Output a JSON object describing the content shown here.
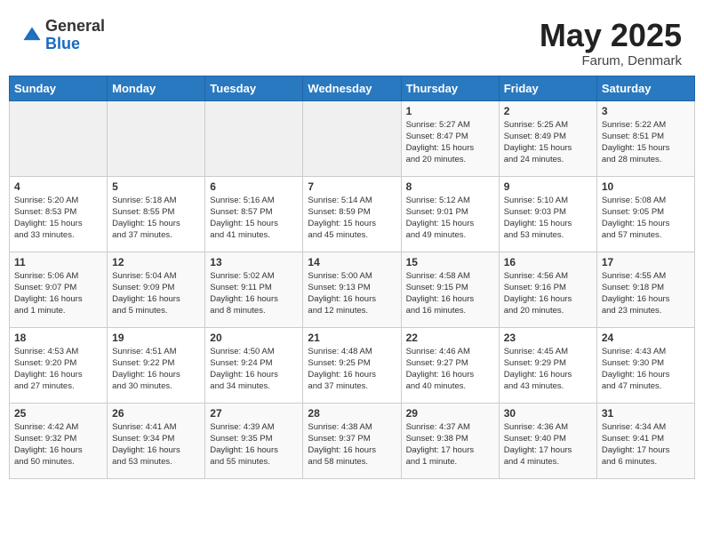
{
  "header": {
    "logo_general": "General",
    "logo_blue": "Blue",
    "title": "May 2025",
    "location": "Farum, Denmark"
  },
  "weekdays": [
    "Sunday",
    "Monday",
    "Tuesday",
    "Wednesday",
    "Thursday",
    "Friday",
    "Saturday"
  ],
  "weeks": [
    [
      {
        "day": "",
        "content": ""
      },
      {
        "day": "",
        "content": ""
      },
      {
        "day": "",
        "content": ""
      },
      {
        "day": "",
        "content": ""
      },
      {
        "day": "1",
        "content": "Sunrise: 5:27 AM\nSunset: 8:47 PM\nDaylight: 15 hours\nand 20 minutes."
      },
      {
        "day": "2",
        "content": "Sunrise: 5:25 AM\nSunset: 8:49 PM\nDaylight: 15 hours\nand 24 minutes."
      },
      {
        "day": "3",
        "content": "Sunrise: 5:22 AM\nSunset: 8:51 PM\nDaylight: 15 hours\nand 28 minutes."
      }
    ],
    [
      {
        "day": "4",
        "content": "Sunrise: 5:20 AM\nSunset: 8:53 PM\nDaylight: 15 hours\nand 33 minutes."
      },
      {
        "day": "5",
        "content": "Sunrise: 5:18 AM\nSunset: 8:55 PM\nDaylight: 15 hours\nand 37 minutes."
      },
      {
        "day": "6",
        "content": "Sunrise: 5:16 AM\nSunset: 8:57 PM\nDaylight: 15 hours\nand 41 minutes."
      },
      {
        "day": "7",
        "content": "Sunrise: 5:14 AM\nSunset: 8:59 PM\nDaylight: 15 hours\nand 45 minutes."
      },
      {
        "day": "8",
        "content": "Sunrise: 5:12 AM\nSunset: 9:01 PM\nDaylight: 15 hours\nand 49 minutes."
      },
      {
        "day": "9",
        "content": "Sunrise: 5:10 AM\nSunset: 9:03 PM\nDaylight: 15 hours\nand 53 minutes."
      },
      {
        "day": "10",
        "content": "Sunrise: 5:08 AM\nSunset: 9:05 PM\nDaylight: 15 hours\nand 57 minutes."
      }
    ],
    [
      {
        "day": "11",
        "content": "Sunrise: 5:06 AM\nSunset: 9:07 PM\nDaylight: 16 hours\nand 1 minute."
      },
      {
        "day": "12",
        "content": "Sunrise: 5:04 AM\nSunset: 9:09 PM\nDaylight: 16 hours\nand 5 minutes."
      },
      {
        "day": "13",
        "content": "Sunrise: 5:02 AM\nSunset: 9:11 PM\nDaylight: 16 hours\nand 8 minutes."
      },
      {
        "day": "14",
        "content": "Sunrise: 5:00 AM\nSunset: 9:13 PM\nDaylight: 16 hours\nand 12 minutes."
      },
      {
        "day": "15",
        "content": "Sunrise: 4:58 AM\nSunset: 9:15 PM\nDaylight: 16 hours\nand 16 minutes."
      },
      {
        "day": "16",
        "content": "Sunrise: 4:56 AM\nSunset: 9:16 PM\nDaylight: 16 hours\nand 20 minutes."
      },
      {
        "day": "17",
        "content": "Sunrise: 4:55 AM\nSunset: 9:18 PM\nDaylight: 16 hours\nand 23 minutes."
      }
    ],
    [
      {
        "day": "18",
        "content": "Sunrise: 4:53 AM\nSunset: 9:20 PM\nDaylight: 16 hours\nand 27 minutes."
      },
      {
        "day": "19",
        "content": "Sunrise: 4:51 AM\nSunset: 9:22 PM\nDaylight: 16 hours\nand 30 minutes."
      },
      {
        "day": "20",
        "content": "Sunrise: 4:50 AM\nSunset: 9:24 PM\nDaylight: 16 hours\nand 34 minutes."
      },
      {
        "day": "21",
        "content": "Sunrise: 4:48 AM\nSunset: 9:25 PM\nDaylight: 16 hours\nand 37 minutes."
      },
      {
        "day": "22",
        "content": "Sunrise: 4:46 AM\nSunset: 9:27 PM\nDaylight: 16 hours\nand 40 minutes."
      },
      {
        "day": "23",
        "content": "Sunrise: 4:45 AM\nSunset: 9:29 PM\nDaylight: 16 hours\nand 43 minutes."
      },
      {
        "day": "24",
        "content": "Sunrise: 4:43 AM\nSunset: 9:30 PM\nDaylight: 16 hours\nand 47 minutes."
      }
    ],
    [
      {
        "day": "25",
        "content": "Sunrise: 4:42 AM\nSunset: 9:32 PM\nDaylight: 16 hours\nand 50 minutes."
      },
      {
        "day": "26",
        "content": "Sunrise: 4:41 AM\nSunset: 9:34 PM\nDaylight: 16 hours\nand 53 minutes."
      },
      {
        "day": "27",
        "content": "Sunrise: 4:39 AM\nSunset: 9:35 PM\nDaylight: 16 hours\nand 55 minutes."
      },
      {
        "day": "28",
        "content": "Sunrise: 4:38 AM\nSunset: 9:37 PM\nDaylight: 16 hours\nand 58 minutes."
      },
      {
        "day": "29",
        "content": "Sunrise: 4:37 AM\nSunset: 9:38 PM\nDaylight: 17 hours\nand 1 minute."
      },
      {
        "day": "30",
        "content": "Sunrise: 4:36 AM\nSunset: 9:40 PM\nDaylight: 17 hours\nand 4 minutes."
      },
      {
        "day": "31",
        "content": "Sunrise: 4:34 AM\nSunset: 9:41 PM\nDaylight: 17 hours\nand 6 minutes."
      }
    ]
  ]
}
